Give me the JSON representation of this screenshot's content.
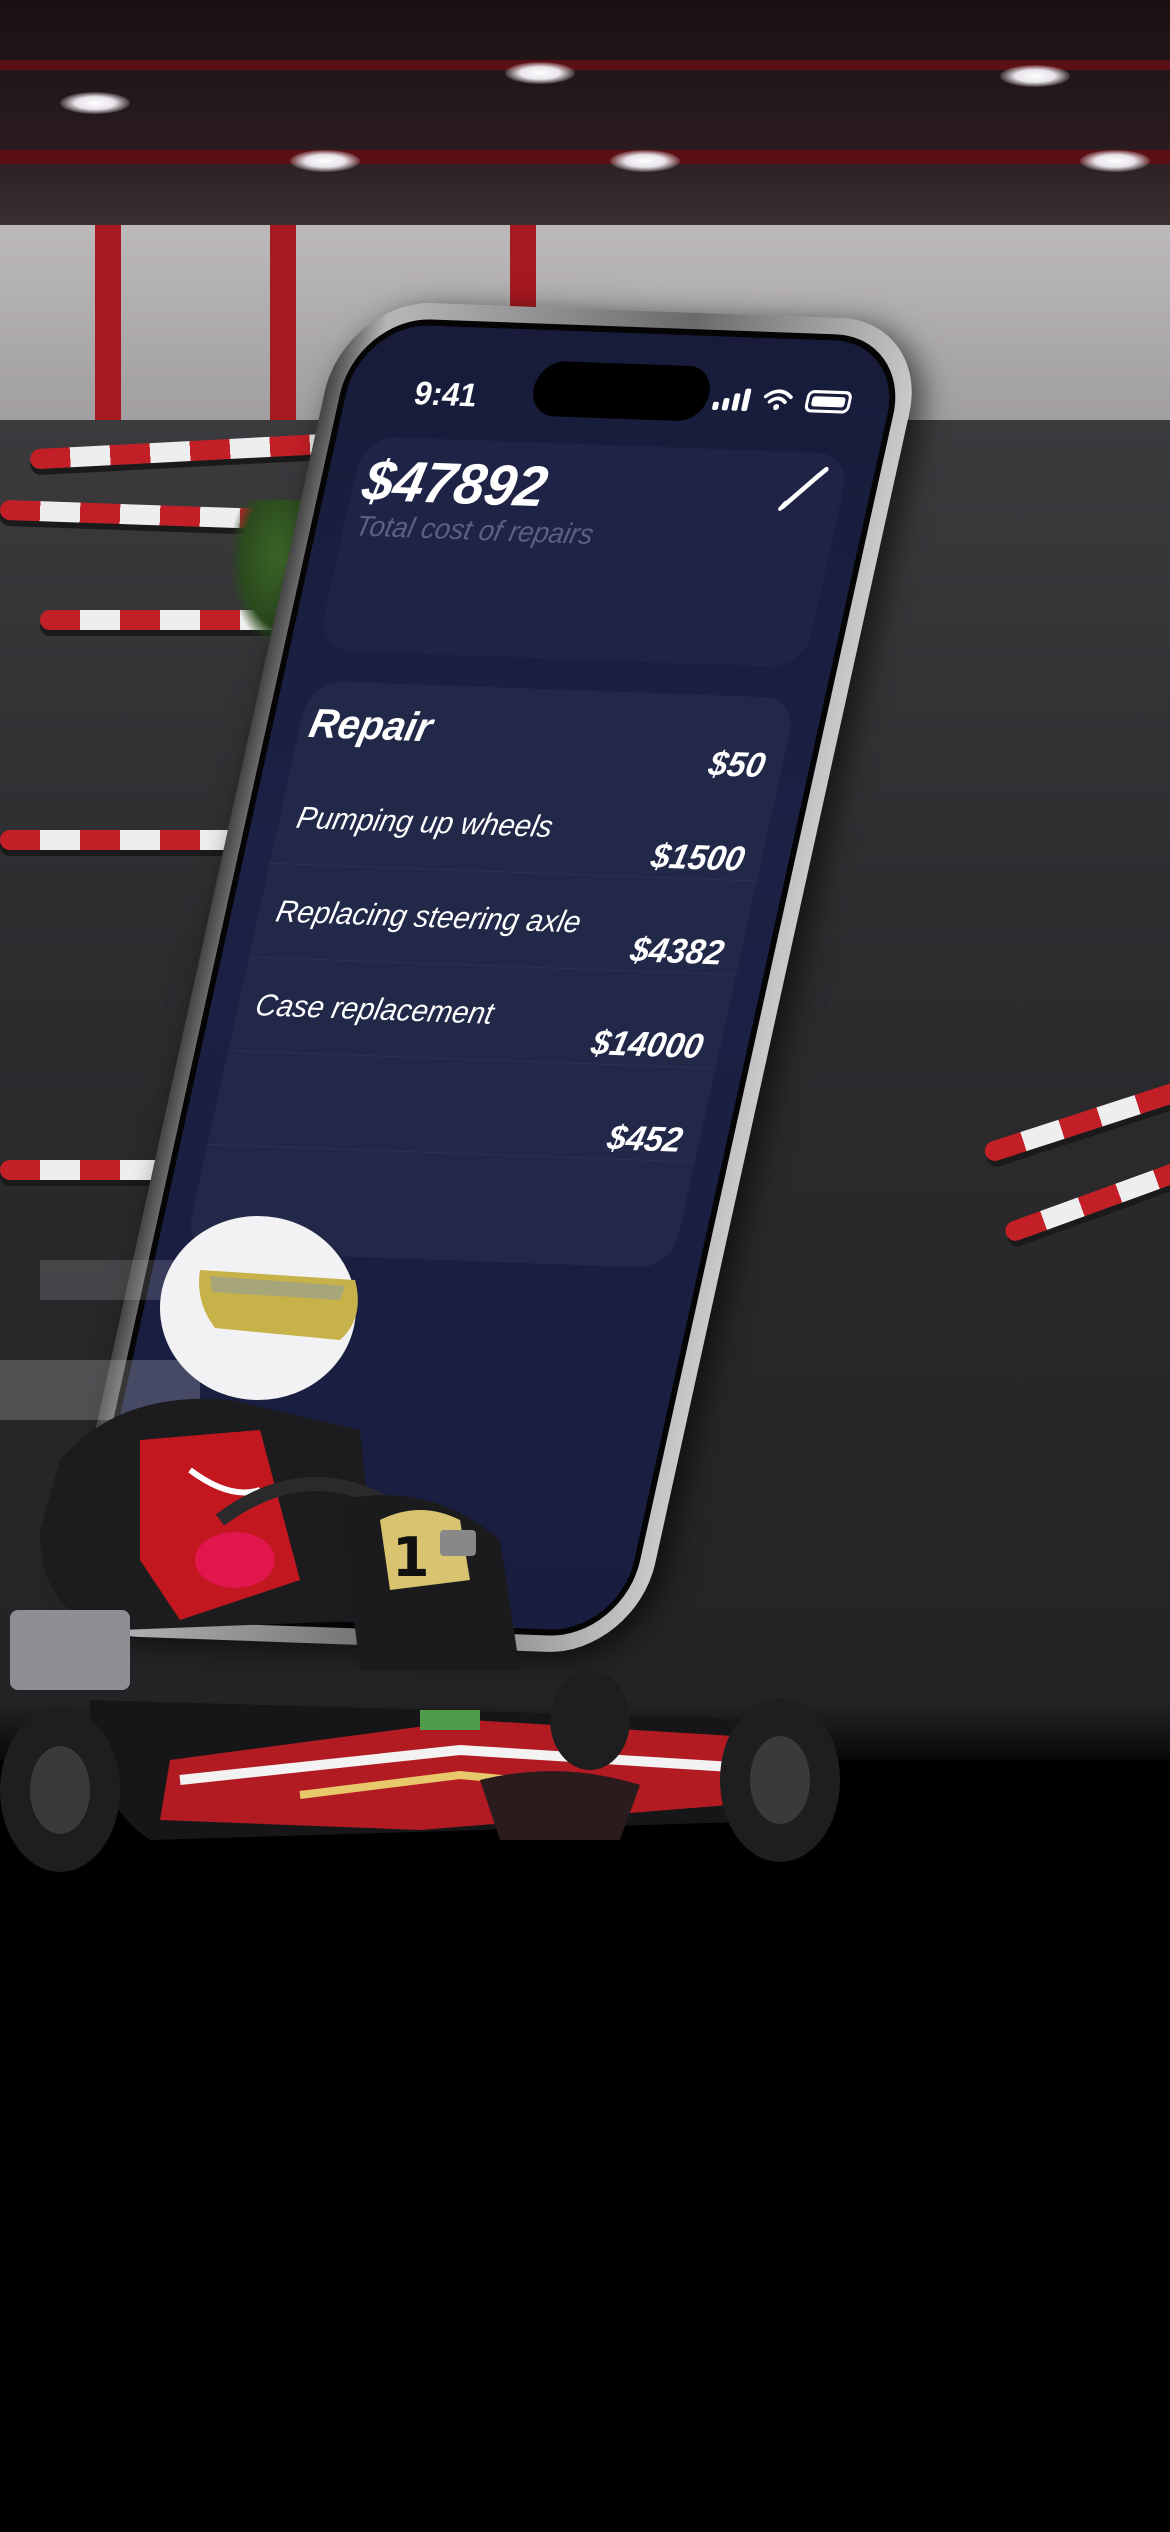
{
  "status_bar": {
    "time": "9:41"
  },
  "summary": {
    "total_value": "$47892",
    "total_label": "Total cost of repairs",
    "edit_icon": "pencil-icon"
  },
  "repairs": {
    "title": "Repair",
    "items": [
      {
        "name": "Pumping up wheels",
        "cost": "$50"
      },
      {
        "name": "Replacing steering axle",
        "cost": "$1500"
      },
      {
        "name": "Case replacement",
        "cost": "$4382"
      },
      {
        "name": "",
        "cost": "$14000"
      },
      {
        "name": "",
        "cost": "$452"
      }
    ]
  },
  "colors": {
    "screen_background": "#1c2145",
    "card_background": "#222848",
    "muted_text": "#5b6185",
    "barrier_red": "#c31f26"
  }
}
